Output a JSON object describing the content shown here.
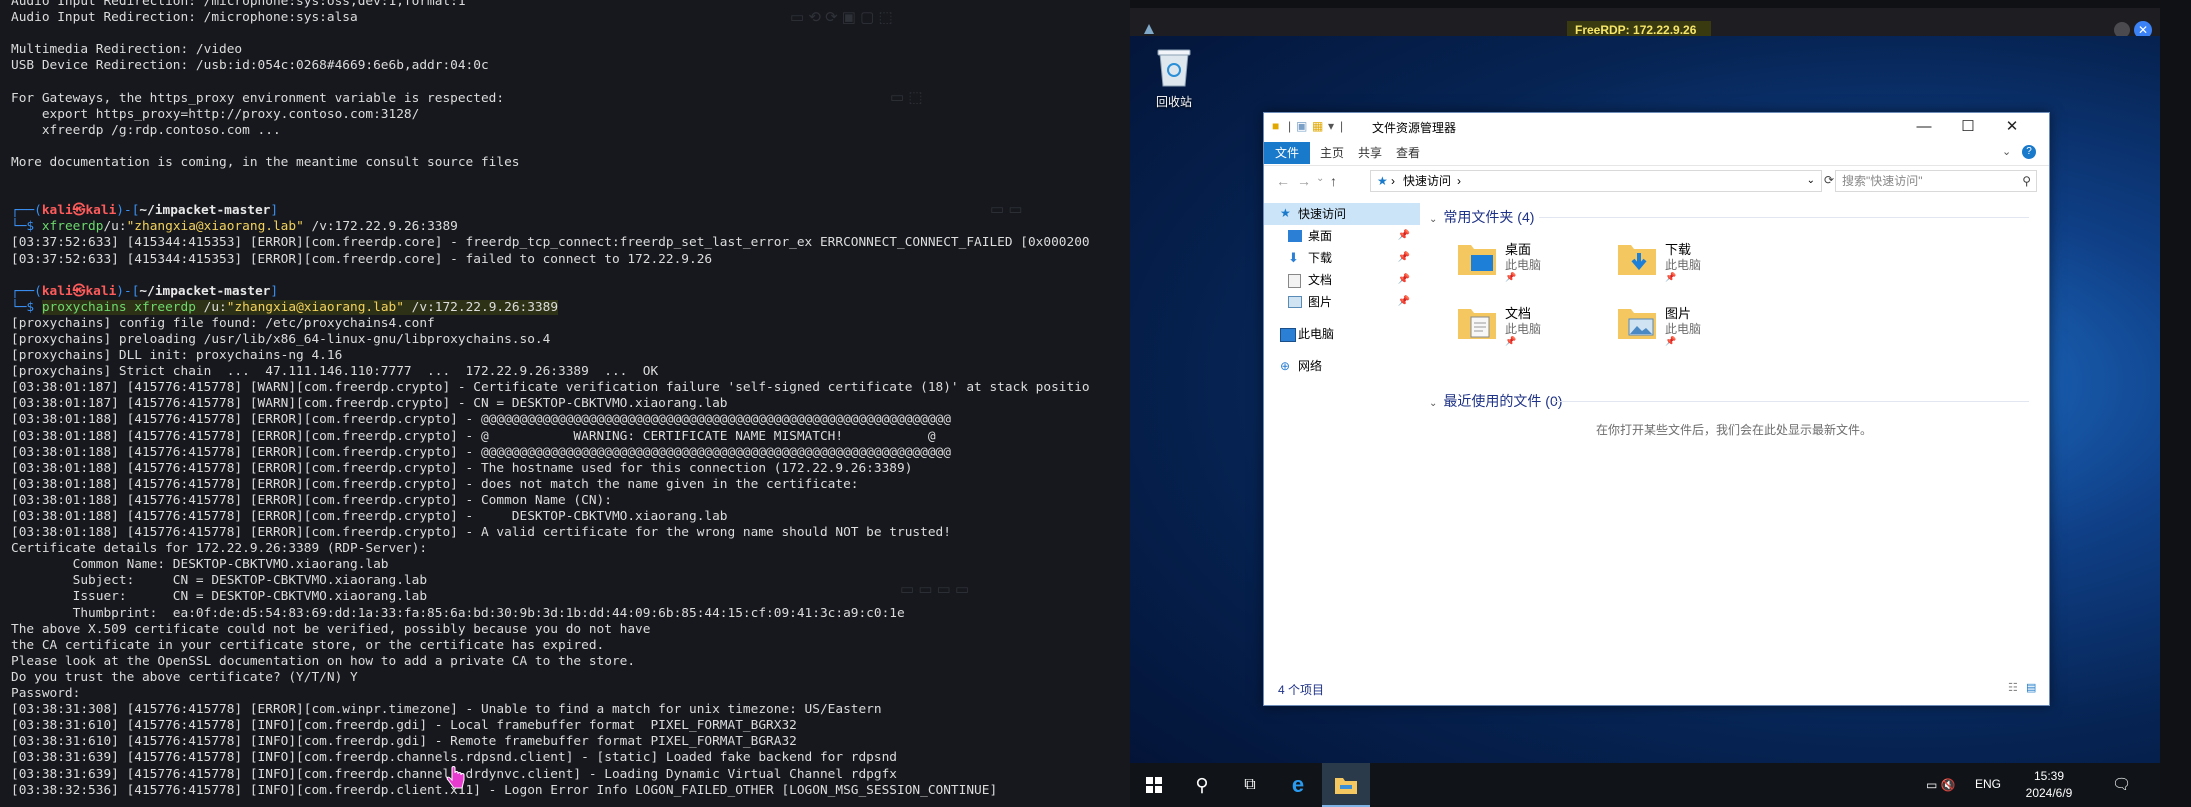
{
  "terminal": {
    "lines": [
      {
        "kind": "plain",
        "text": "Audio Input Redirection: /microphone:sys:oss,dev:1,format:1"
      },
      {
        "kind": "plain",
        "text": "Audio Input Redirection: /microphone:sys:alsa"
      },
      {
        "kind": "plain",
        "text": ""
      },
      {
        "kind": "plain",
        "text": "Multimedia Redirection: /video"
      },
      {
        "kind": "plain",
        "text": "USB Device Redirection: /usb:id:054c:0268#4669:6e6b,addr:04:0c"
      },
      {
        "kind": "plain",
        "text": ""
      },
      {
        "kind": "plain",
        "text": "For Gateways, the https_proxy environment variable is respected:"
      },
      {
        "kind": "plain",
        "text": "    export https_proxy=http://proxy.contoso.com:3128/"
      },
      {
        "kind": "plain",
        "text": "    xfreerdp /g:rdp.contoso.com ..."
      },
      {
        "kind": "plain",
        "text": ""
      },
      {
        "kind": "plain",
        "text": "More documentation is coming, in the meantime consult source files"
      },
      {
        "kind": "plain",
        "text": ""
      },
      {
        "kind": "plain",
        "text": ""
      },
      {
        "kind": "prompt_top",
        "user": "kali",
        "host": "kali",
        "dir": "~/impacket-master"
      },
      {
        "kind": "cmd",
        "prog": "xfreerdp",
        "arg1": "/u:",
        "str": "\"zhangxia@xiaorang.lab\"",
        "arg2": " /v:172.22.9.26:3389",
        "hl": false
      },
      {
        "kind": "plain",
        "text": "[03:37:52:633] [415344:415353] [ERROR][com.freerdp.core] - freerdp_tcp_connect:freerdp_set_last_error_ex ERRCONNECT_CONNECT_FAILED [0x000200"
      },
      {
        "kind": "plain",
        "text": "[03:37:52:633] [415344:415353] [ERROR][com.freerdp.core] - failed to connect to 172.22.9.26"
      },
      {
        "kind": "plain",
        "text": ""
      },
      {
        "kind": "prompt_top",
        "user": "kali",
        "host": "kali",
        "dir": "~/impacket-master"
      },
      {
        "kind": "cmd",
        "prog": "proxychains",
        "arg0": " xfreerdp",
        "arg1": " /u:",
        "str": "\"zhangxia@xiaorang.lab\"",
        "arg2": " /v:172.22.9.26:3389",
        "hl": true
      },
      {
        "kind": "plain",
        "text": "[proxychains] config file found: /etc/proxychains4.conf"
      },
      {
        "kind": "plain",
        "text": "[proxychains] preloading /usr/lib/x86_64-linux-gnu/libproxychains.so.4"
      },
      {
        "kind": "plain",
        "text": "[proxychains] DLL init: proxychains-ng 4.16"
      },
      {
        "kind": "plain",
        "text": "[proxychains] Strict chain  ...  47.111.146.110:7777  ...  172.22.9.26:3389  ...  OK"
      },
      {
        "kind": "plain",
        "text": "[03:38:01:187] [415776:415778] [WARN][com.freerdp.crypto] - Certificate verification failure 'self-signed certificate (18)' at stack positio"
      },
      {
        "kind": "plain",
        "text": "[03:38:01:187] [415776:415778] [WARN][com.freerdp.crypto] - CN = DESKTOP-CBKTVMO.xiaorang.lab"
      },
      {
        "kind": "plain",
        "text": "[03:38:01:188] [415776:415778] [ERROR][com.freerdp.crypto] - @@@@@@@@@@@@@@@@@@@@@@@@@@@@@@@@@@@@@@@@@@@@@@@@@@@@@@@@@@@@@"
      },
      {
        "kind": "plain",
        "text": "[03:38:01:188] [415776:415778] [ERROR][com.freerdp.crypto] - @           WARNING: CERTIFICATE NAME MISMATCH!           @"
      },
      {
        "kind": "plain",
        "text": "[03:38:01:188] [415776:415778] [ERROR][com.freerdp.crypto] - @@@@@@@@@@@@@@@@@@@@@@@@@@@@@@@@@@@@@@@@@@@@@@@@@@@@@@@@@@@@@"
      },
      {
        "kind": "plain",
        "text": "[03:38:01:188] [415776:415778] [ERROR][com.freerdp.crypto] - The hostname used for this connection (172.22.9.26:3389)"
      },
      {
        "kind": "plain",
        "text": "[03:38:01:188] [415776:415778] [ERROR][com.freerdp.crypto] - does not match the name given in the certificate:"
      },
      {
        "kind": "plain",
        "text": "[03:38:01:188] [415776:415778] [ERROR][com.freerdp.crypto] - Common Name (CN):"
      },
      {
        "kind": "plain",
        "text": "[03:38:01:188] [415776:415778] [ERROR][com.freerdp.crypto] -     DESKTOP-CBKTVMO.xiaorang.lab"
      },
      {
        "kind": "plain",
        "text": "[03:38:01:188] [415776:415778] [ERROR][com.freerdp.crypto] - A valid certificate for the wrong name should NOT be trusted!"
      },
      {
        "kind": "plain",
        "text": "Certificate details for 172.22.9.26:3389 (RDP-Server):"
      },
      {
        "kind": "plain",
        "text": "        Common Name: DESKTOP-CBKTVMO.xiaorang.lab"
      },
      {
        "kind": "plain",
        "text": "        Subject:     CN = DESKTOP-CBKTVMO.xiaorang.lab"
      },
      {
        "kind": "plain",
        "text": "        Issuer:      CN = DESKTOP-CBKTVMO.xiaorang.lab"
      },
      {
        "kind": "plain",
        "text": "        Thumbprint:  ea:0f:de:d5:54:83:69:dd:1a:33:fa:85:6a:bd:30:9b:3d:1b:dd:44:09:6b:85:44:15:cf:09:41:3c:a9:c0:1e"
      },
      {
        "kind": "plain",
        "text": "The above X.509 certificate could not be verified, possibly because you do not have"
      },
      {
        "kind": "plain",
        "text": "the CA certificate in your certificate store, or the certificate has expired."
      },
      {
        "kind": "plain",
        "text": "Please look at the OpenSSL documentation on how to add a private CA to the store."
      },
      {
        "kind": "plain",
        "text": "Do you trust the above certificate? (Y/T/N) Y"
      },
      {
        "kind": "plain",
        "text": "Password:"
      },
      {
        "kind": "plain",
        "text": "[03:38:31:308] [415776:415778] [ERROR][com.winpr.timezone] - Unable to find a match for unix timezone: US/Eastern"
      },
      {
        "kind": "plain",
        "text": "[03:38:31:610] [415776:415778] [INFO][com.freerdp.gdi] - Local framebuffer format  PIXEL_FORMAT_BGRX32"
      },
      {
        "kind": "plain",
        "text": "[03:38:31:610] [415776:415778] [INFO][com.freerdp.gdi] - Remote framebuffer format PIXEL_FORMAT_BGRA32"
      },
      {
        "kind": "plain",
        "text": "[03:38:31:639] [415776:415778] [INFO][com.freerdp.channels.rdpsnd.client] - [static] Loaded fake backend for rdpsnd"
      },
      {
        "kind": "plain",
        "text": "[03:38:31:639] [415776:415778] [INFO][com.freerdp.channels.drdynvc.client] - Loading Dynamic Virtual Channel rdpgfx"
      },
      {
        "kind": "plain",
        "text": "[03:38:32:536] [415776:415778] [INFO][com.freerdp.client.x11] - Logon Error Info LOGON_FAILED_OTHER [LOGON_MSG_SESSION_CONTINUE]"
      }
    ]
  },
  "rdp": {
    "title": "FreeRDP: 172.22.9.26",
    "desktop": {
      "recycle_bin_label": "回收站"
    },
    "explorer": {
      "title": "文件资源管理器",
      "ribbon_tabs": [
        "文件",
        "主页",
        "共享",
        "查看"
      ],
      "address_path": "快速访问",
      "search_placeholder": "搜索\"快速访问\"",
      "nav": [
        {
          "label": "快速访问",
          "icon": "star-icon",
          "pinned": false,
          "selected": true
        },
        {
          "label": "桌面",
          "icon": "desktop-icon",
          "pinned": true,
          "selected": false
        },
        {
          "label": "下载",
          "icon": "download-icon",
          "pinned": true,
          "selected": false
        },
        {
          "label": "文档",
          "icon": "document-icon",
          "pinned": true,
          "selected": false
        },
        {
          "label": "图片",
          "icon": "picture-icon",
          "pinned": true,
          "selected": false
        },
        {
          "label": "此电脑",
          "icon": "computer-icon",
          "pinned": false,
          "selected": false
        },
        {
          "label": "网络",
          "icon": "network-icon",
          "pinned": false,
          "selected": false
        }
      ],
      "frequent_header": "常用文件夹 (4)",
      "folders": [
        {
          "name": "桌面",
          "sub": "此电脑",
          "type": "desktop"
        },
        {
          "name": "下载",
          "sub": "此电脑",
          "type": "download"
        },
        {
          "name": "文档",
          "sub": "此电脑",
          "type": "document"
        },
        {
          "name": "图片",
          "sub": "此电脑",
          "type": "picture"
        }
      ],
      "recent_header": "最近使用的文件 (0)",
      "recent_empty_text": "在你打开某些文件后，我们会在此处显示最新文件。",
      "status_text": "4 个项目"
    },
    "taskbar": {
      "lang": "ENG",
      "time": "15:39",
      "date": "2024/6/9"
    }
  },
  "colors": {
    "terminal_bg": "#16181d",
    "prompt_blue": "#3a8ff0",
    "prompt_user_red": "#ff5b5b",
    "command_green": "#6cd96c",
    "string_yellow": "#f2d15c",
    "ribbon_blue": "#1979ca",
    "rdp_title_yellow": "#f5e66a"
  }
}
